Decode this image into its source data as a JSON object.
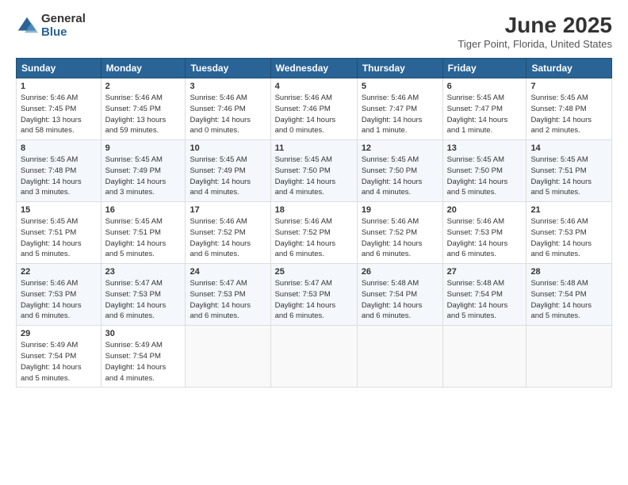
{
  "header": {
    "logo_general": "General",
    "logo_blue": "Blue",
    "month_title": "June 2025",
    "location": "Tiger Point, Florida, United States"
  },
  "weekdays": [
    "Sunday",
    "Monday",
    "Tuesday",
    "Wednesday",
    "Thursday",
    "Friday",
    "Saturday"
  ],
  "weeks": [
    [
      {
        "day": "1",
        "info": "Sunrise: 5:46 AM\nSunset: 7:45 PM\nDaylight: 13 hours\nand 58 minutes."
      },
      {
        "day": "2",
        "info": "Sunrise: 5:46 AM\nSunset: 7:45 PM\nDaylight: 13 hours\nand 59 minutes."
      },
      {
        "day": "3",
        "info": "Sunrise: 5:46 AM\nSunset: 7:46 PM\nDaylight: 14 hours\nand 0 minutes."
      },
      {
        "day": "4",
        "info": "Sunrise: 5:46 AM\nSunset: 7:46 PM\nDaylight: 14 hours\nand 0 minutes."
      },
      {
        "day": "5",
        "info": "Sunrise: 5:46 AM\nSunset: 7:47 PM\nDaylight: 14 hours\nand 1 minute."
      },
      {
        "day": "6",
        "info": "Sunrise: 5:45 AM\nSunset: 7:47 PM\nDaylight: 14 hours\nand 1 minute."
      },
      {
        "day": "7",
        "info": "Sunrise: 5:45 AM\nSunset: 7:48 PM\nDaylight: 14 hours\nand 2 minutes."
      }
    ],
    [
      {
        "day": "8",
        "info": "Sunrise: 5:45 AM\nSunset: 7:48 PM\nDaylight: 14 hours\nand 3 minutes."
      },
      {
        "day": "9",
        "info": "Sunrise: 5:45 AM\nSunset: 7:49 PM\nDaylight: 14 hours\nand 3 minutes."
      },
      {
        "day": "10",
        "info": "Sunrise: 5:45 AM\nSunset: 7:49 PM\nDaylight: 14 hours\nand 4 minutes."
      },
      {
        "day": "11",
        "info": "Sunrise: 5:45 AM\nSunset: 7:50 PM\nDaylight: 14 hours\nand 4 minutes."
      },
      {
        "day": "12",
        "info": "Sunrise: 5:45 AM\nSunset: 7:50 PM\nDaylight: 14 hours\nand 4 minutes."
      },
      {
        "day": "13",
        "info": "Sunrise: 5:45 AM\nSunset: 7:50 PM\nDaylight: 14 hours\nand 5 minutes."
      },
      {
        "day": "14",
        "info": "Sunrise: 5:45 AM\nSunset: 7:51 PM\nDaylight: 14 hours\nand 5 minutes."
      }
    ],
    [
      {
        "day": "15",
        "info": "Sunrise: 5:45 AM\nSunset: 7:51 PM\nDaylight: 14 hours\nand 5 minutes."
      },
      {
        "day": "16",
        "info": "Sunrise: 5:45 AM\nSunset: 7:51 PM\nDaylight: 14 hours\nand 5 minutes."
      },
      {
        "day": "17",
        "info": "Sunrise: 5:46 AM\nSunset: 7:52 PM\nDaylight: 14 hours\nand 6 minutes."
      },
      {
        "day": "18",
        "info": "Sunrise: 5:46 AM\nSunset: 7:52 PM\nDaylight: 14 hours\nand 6 minutes."
      },
      {
        "day": "19",
        "info": "Sunrise: 5:46 AM\nSunset: 7:52 PM\nDaylight: 14 hours\nand 6 minutes."
      },
      {
        "day": "20",
        "info": "Sunrise: 5:46 AM\nSunset: 7:53 PM\nDaylight: 14 hours\nand 6 minutes."
      },
      {
        "day": "21",
        "info": "Sunrise: 5:46 AM\nSunset: 7:53 PM\nDaylight: 14 hours\nand 6 minutes."
      }
    ],
    [
      {
        "day": "22",
        "info": "Sunrise: 5:46 AM\nSunset: 7:53 PM\nDaylight: 14 hours\nand 6 minutes."
      },
      {
        "day": "23",
        "info": "Sunrise: 5:47 AM\nSunset: 7:53 PM\nDaylight: 14 hours\nand 6 minutes."
      },
      {
        "day": "24",
        "info": "Sunrise: 5:47 AM\nSunset: 7:53 PM\nDaylight: 14 hours\nand 6 minutes."
      },
      {
        "day": "25",
        "info": "Sunrise: 5:47 AM\nSunset: 7:53 PM\nDaylight: 14 hours\nand 6 minutes."
      },
      {
        "day": "26",
        "info": "Sunrise: 5:48 AM\nSunset: 7:54 PM\nDaylight: 14 hours\nand 6 minutes."
      },
      {
        "day": "27",
        "info": "Sunrise: 5:48 AM\nSunset: 7:54 PM\nDaylight: 14 hours\nand 5 minutes."
      },
      {
        "day": "28",
        "info": "Sunrise: 5:48 AM\nSunset: 7:54 PM\nDaylight: 14 hours\nand 5 minutes."
      }
    ],
    [
      {
        "day": "29",
        "info": "Sunrise: 5:49 AM\nSunset: 7:54 PM\nDaylight: 14 hours\nand 5 minutes."
      },
      {
        "day": "30",
        "info": "Sunrise: 5:49 AM\nSunset: 7:54 PM\nDaylight: 14 hours\nand 4 minutes."
      },
      {
        "day": "",
        "info": ""
      },
      {
        "day": "",
        "info": ""
      },
      {
        "day": "",
        "info": ""
      },
      {
        "day": "",
        "info": ""
      },
      {
        "day": "",
        "info": ""
      }
    ]
  ]
}
